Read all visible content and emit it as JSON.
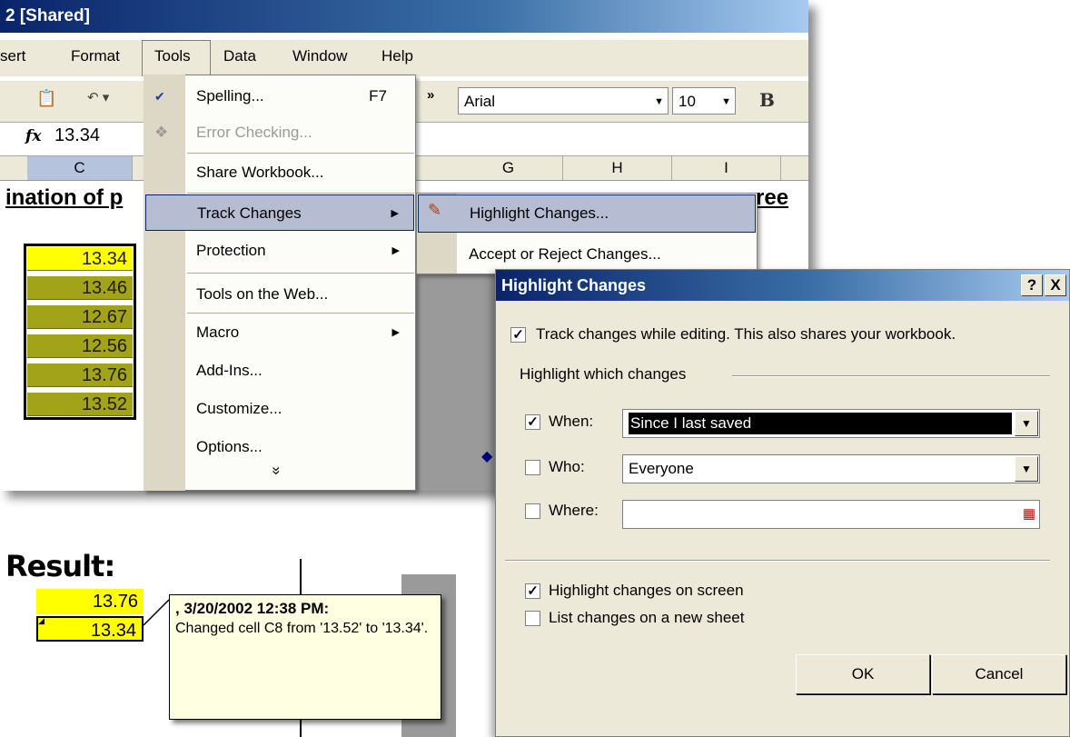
{
  "excel": {
    "title": "2  [Shared]",
    "menu": [
      "sert",
      "Format",
      "Tools",
      "Data",
      "Window",
      "Help"
    ],
    "font_name": "Arial",
    "font_size": "10",
    "bold_label": "B",
    "formula_icon": "fx",
    "formula_value": "13.34",
    "columns": [
      "C",
      "G",
      "H",
      "I"
    ],
    "sheet_title_left": "ination of p",
    "sheet_title_right": "ree",
    "cells": [
      "13.34",
      "13.46",
      "12.67",
      "12.56",
      "13.76",
      "13.52"
    ]
  },
  "tools_menu": {
    "spelling": "Spelling...",
    "spelling_key": "F7",
    "error_checking": "Error Checking...",
    "share_workbook": "Share Workbook...",
    "track_changes": "Track Changes",
    "protection": "Protection",
    "tools_on_web": "Tools on the Web...",
    "macro": "Macro",
    "add_ins": "Add-Ins...",
    "customize": "Customize...",
    "options": "Options...",
    "expand": "»"
  },
  "submenu": {
    "highlight": "Highlight Changes...",
    "accept_reject": "Accept or Reject Changes..."
  },
  "dialog": {
    "title": "Highlight Changes",
    "help_btn": "?",
    "close_btn": "X",
    "track_label": "Track changes while editing. This also shares your workbook.",
    "group_label": "Highlight which changes",
    "when_label": "When:",
    "when_value": "Since I last saved",
    "who_label": "Who:",
    "who_value": "Everyone",
    "where_label": "Where:",
    "where_value": "",
    "highlight_screen": "Highlight changes on screen",
    "list_sheet": "List changes on a new sheet",
    "ok": "OK",
    "cancel": "Cancel",
    "checked": {
      "track": true,
      "when": true,
      "who": false,
      "where": false,
      "screen": true,
      "list": false
    }
  },
  "result": {
    "label": "Result:",
    "cells": [
      "13.76",
      "13.34"
    ],
    "comment_header": ", 3/20/2002 12:38 PM:",
    "comment_body": "Changed cell C8 from '13.52' to '13.34'."
  }
}
